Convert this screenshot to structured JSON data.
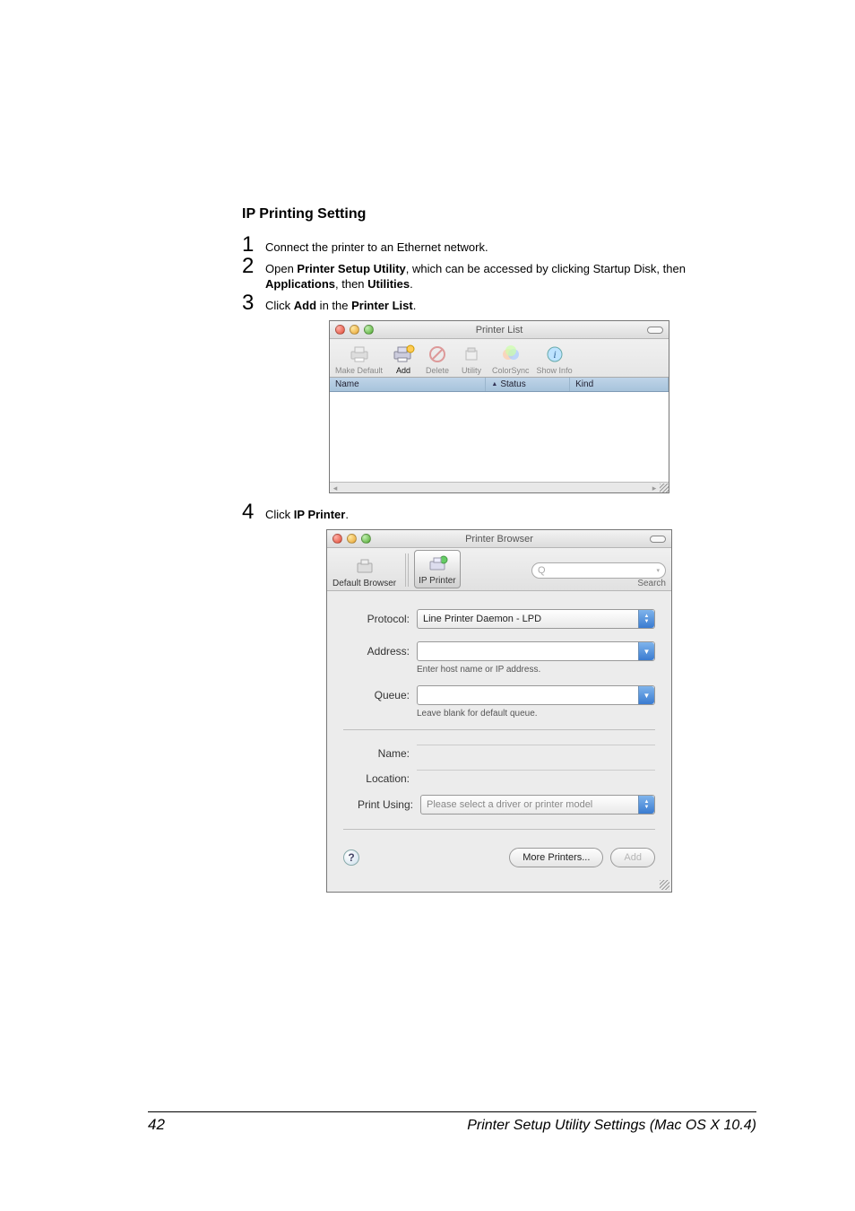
{
  "heading": "IP Printing Setting",
  "steps": {
    "s1": {
      "num": "1",
      "text_a": "Connect the printer to an Ethernet network."
    },
    "s2": {
      "num": "2",
      "text_a": "Open ",
      "b1": "Printer Setup Utility",
      "text_b": ", which can be accessed by clicking Startup Disk, then ",
      "b2": "Applications",
      "text_c": ", then ",
      "b3": "Utilities",
      "text_d": "."
    },
    "s3": {
      "num": "3",
      "text_a": "Click ",
      "b1": "Add",
      "text_b": " in the ",
      "b2": "Printer List",
      "text_c": "."
    },
    "s4": {
      "num": "4",
      "text_a": "Click ",
      "b1": "IP Printer",
      "text_b": "."
    }
  },
  "printerlist": {
    "title": "Printer List",
    "toolbar": {
      "make_default": "Make Default",
      "add": "Add",
      "delete": "Delete",
      "utility": "Utility",
      "colorsync": "ColorSync",
      "showinfo": "Show Info"
    },
    "columns": {
      "name": "Name",
      "status": "Status",
      "kind": "Kind"
    }
  },
  "browser": {
    "title": "Printer Browser",
    "tabs": {
      "default": "Default Browser",
      "ip": "IP Printer"
    },
    "search_placeholder": "Q",
    "search_label": "Search",
    "labels": {
      "protocol": "Protocol:",
      "address": "Address:",
      "queue": "Queue:",
      "name": "Name:",
      "location": "Location:",
      "print_using": "Print Using:"
    },
    "protocol_value": "Line Printer Daemon - LPD",
    "address_hint": "Enter host name or IP address.",
    "queue_hint": "Leave blank for default queue.",
    "print_using_value": "Please select a driver or printer model",
    "buttons": {
      "more": "More Printers...",
      "add": "Add"
    },
    "help": "?"
  },
  "footer": {
    "page": "42",
    "title": "Printer Setup Utility Settings (Mac OS X 10.4)"
  },
  "icons": {
    "sort_asc": "▲",
    "arrow_up": "▲",
    "arrow_down": "▼",
    "dropdown": "▼",
    "mag": "Q"
  }
}
